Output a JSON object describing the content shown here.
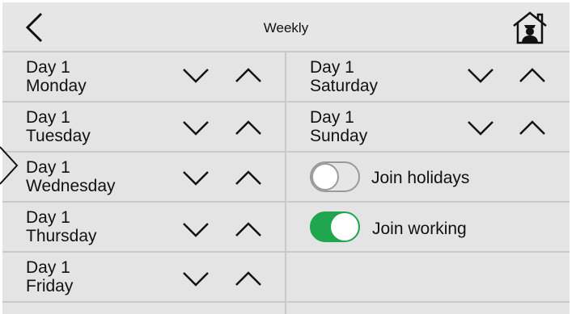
{
  "header": {
    "title": "Weekly",
    "back_icon": "chevron-left-icon",
    "home_icon": "home-person-icon"
  },
  "days": [
    {
      "line1": "Day 1",
      "line2": "Monday"
    },
    {
      "line1": "Day 1",
      "line2": "Tuesday"
    },
    {
      "line1": "Day 1",
      "line2": "Wednesday"
    },
    {
      "line1": "Day 1",
      "line2": "Thursday"
    },
    {
      "line1": "Day 1",
      "line2": "Friday"
    },
    {
      "line1": "Day 1",
      "line2": "Saturday"
    },
    {
      "line1": "Day 1",
      "line2": "Sunday"
    }
  ],
  "toggles": {
    "holidays": {
      "label": "Join holidays",
      "on": false
    },
    "working": {
      "label": "Join working",
      "on": true
    }
  },
  "colors": {
    "background": "#e4e4e4",
    "divider": "#c9c9c9",
    "toggle_on": "#1fa64e",
    "toggle_off_border": "#9a9a9a"
  }
}
